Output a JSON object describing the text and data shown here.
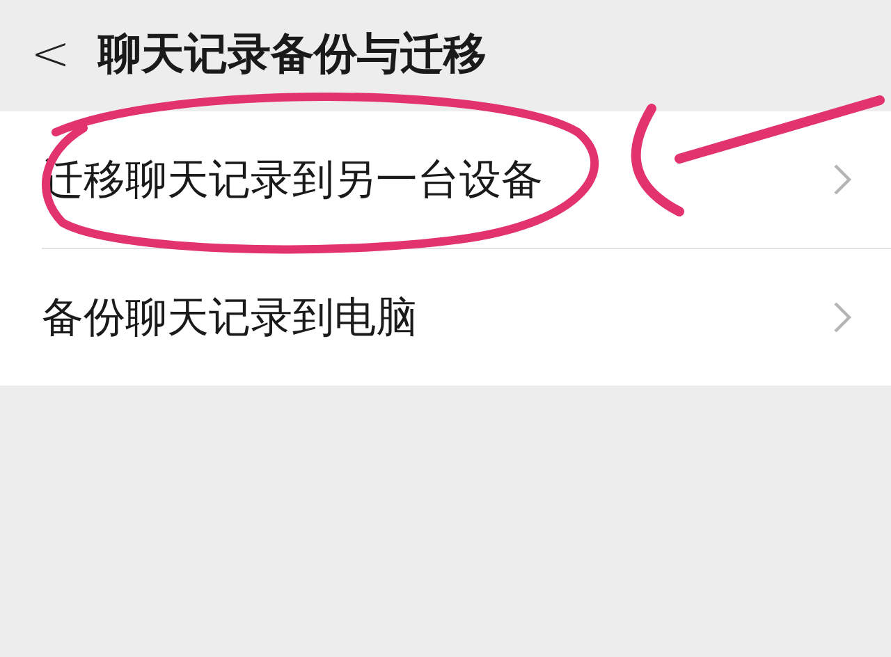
{
  "header": {
    "back": "<",
    "title": "聊天记录备份与迁移"
  },
  "items": [
    {
      "label": "迁移聊天记录到另一台设备"
    },
    {
      "label": "备份聊天记录到电脑"
    }
  ]
}
